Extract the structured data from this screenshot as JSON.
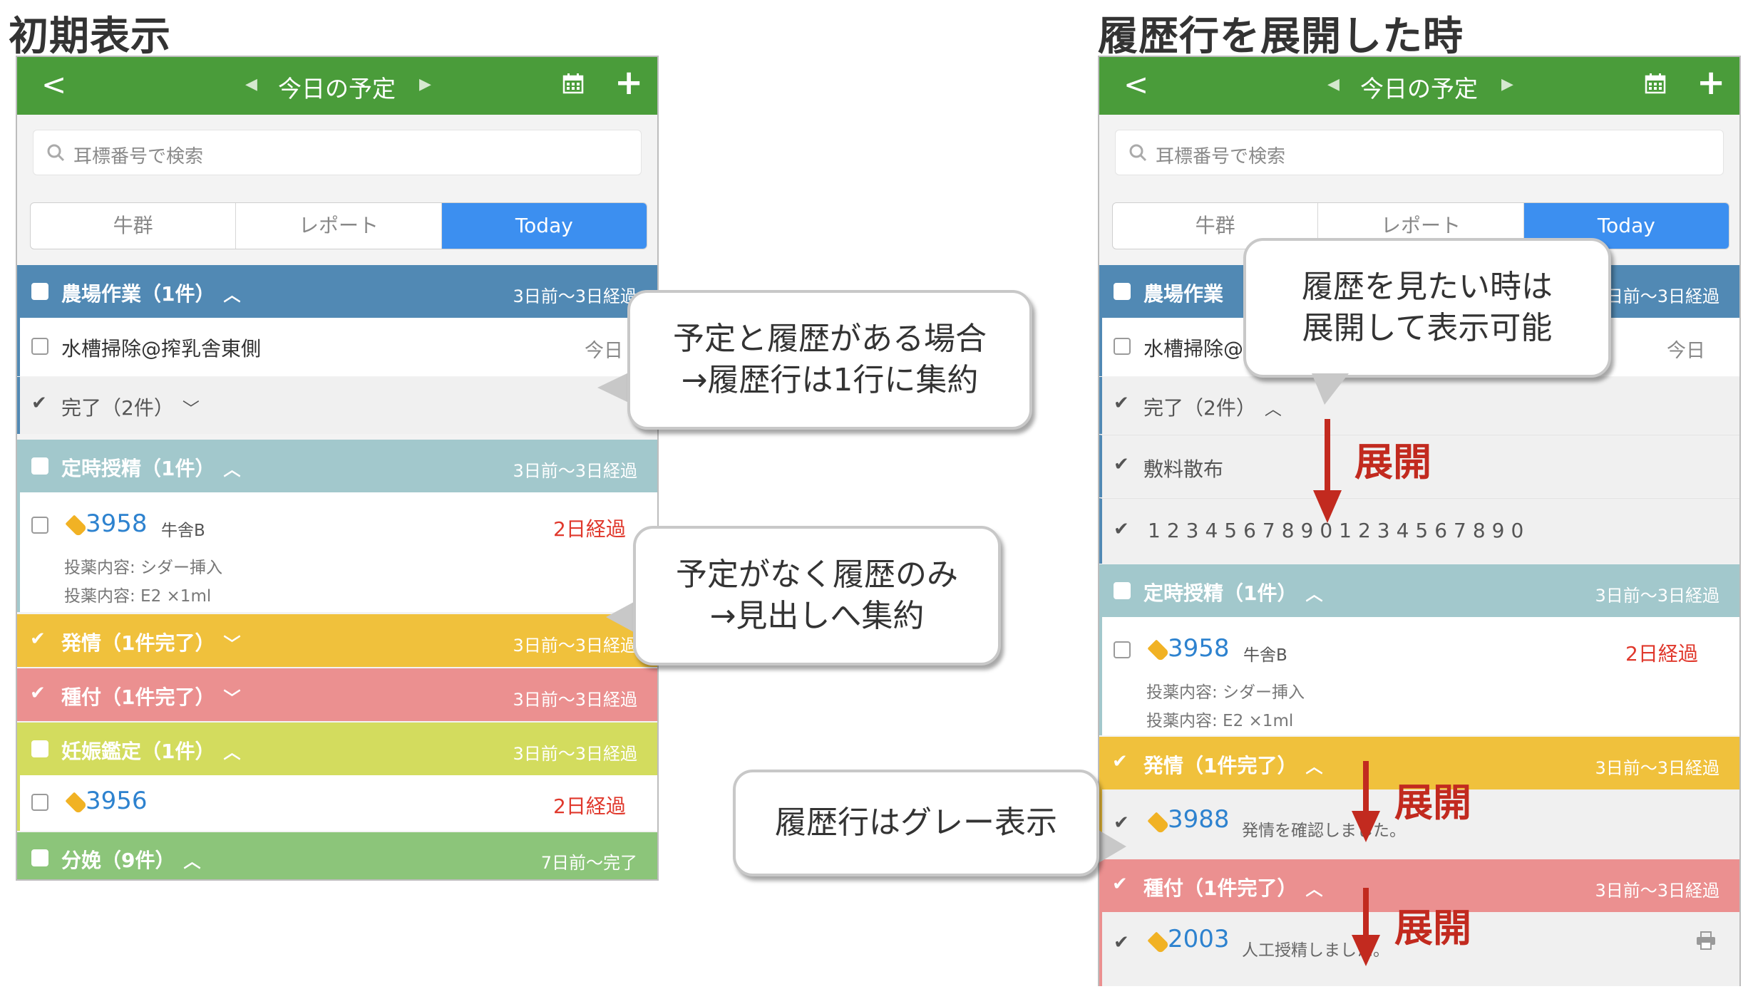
{
  "headings": {
    "initial": "初期表示",
    "expanded": "履歴行を展開した時"
  },
  "app": {
    "title": "今日の予定",
    "search_placeholder": "耳標番号で検索",
    "tabs": [
      "牛群",
      "レポート",
      "Today"
    ],
    "active_tab": "Today"
  },
  "left": {
    "farm": {
      "label": "農場作業（1件）",
      "range": "3日前〜3日経過",
      "color": "#5189b4"
    },
    "farm_task": {
      "label": "水槽掃除@搾乳舎東側",
      "date": "今日"
    },
    "done": {
      "label": "完了（2件）"
    },
    "regular": {
      "label": "定時授精（1件）",
      "range": "3日前〜3日経過",
      "color": "#a2c8cc"
    },
    "cow1": {
      "id": "3958",
      "barn": "牛舎B",
      "status": "2日経過",
      "drug1": "投薬内容: シダー挿入",
      "drug2": "投薬内容: E2 ×1ml"
    },
    "estrus": {
      "label": "発情（1件完了）",
      "range": "3日前〜3日経過",
      "color": "#f0c13c"
    },
    "insem": {
      "label": "種付（1件完了）",
      "range": "3日前〜3日経過",
      "color": "#eb9090"
    },
    "preg": {
      "label": "妊娠鑑定（1件）",
      "range": "3日前〜3日経過",
      "color": "#d3dc5e"
    },
    "cow2": {
      "id": "3956",
      "status": "2日経過"
    },
    "calving": {
      "label": "分娩（9件）",
      "range": "7日前〜完了",
      "color": "#8cc57a"
    }
  },
  "right": {
    "farm": {
      "label": "農場作業",
      "range": "3日前〜3日経過"
    },
    "farm_task": {
      "label": "水槽掃除@",
      "date": "今日"
    },
    "done": {
      "label": "完了（2件）"
    },
    "hist1": "敷料散布",
    "hist2": "12345678901234567890",
    "regular": {
      "label": "定時授精（1件）",
      "range": "3日前〜3日経過"
    },
    "cow1": {
      "id": "3958",
      "barn": "牛舎B",
      "status": "2日経過",
      "drug1": "投薬内容: シダー挿入",
      "drug2": "投薬内容: E2 ×1ml"
    },
    "estrus": {
      "label": "発情（1件完了）",
      "range": "3日前〜3日経過"
    },
    "estrus_hist": {
      "id": "3988",
      "note": "発情を確認しました。"
    },
    "insem": {
      "label": "種付（1件完了）",
      "range": "3日前〜3日経過"
    },
    "insem_hist": {
      "id": "2003",
      "note": "人工授精しました。"
    }
  },
  "callouts": {
    "c1": [
      "予定と履歴がある場合",
      "→履歴行は1行に集約"
    ],
    "c2": [
      "予定がなく履歴のみ",
      "→見出しへ集約"
    ],
    "c3": [
      "履歴行はグレー表示"
    ],
    "c4": [
      "履歴を見たい時は",
      "展開して表示可能"
    ]
  },
  "annotations": {
    "expand": "展開"
  },
  "icons": {
    "back": "chevron-left-icon",
    "calendar": "calendar-icon",
    "add": "plus-icon",
    "search": "search-icon",
    "tag": "tag-icon",
    "check": "check-icon",
    "print": "print-icon"
  },
  "colors": {
    "header_green": "#4a9c3a",
    "tab_active": "#3c8ff0",
    "link_blue": "#2d82cf",
    "overdue_red": "#e0382c",
    "annotation_red": "#c22a1f"
  }
}
